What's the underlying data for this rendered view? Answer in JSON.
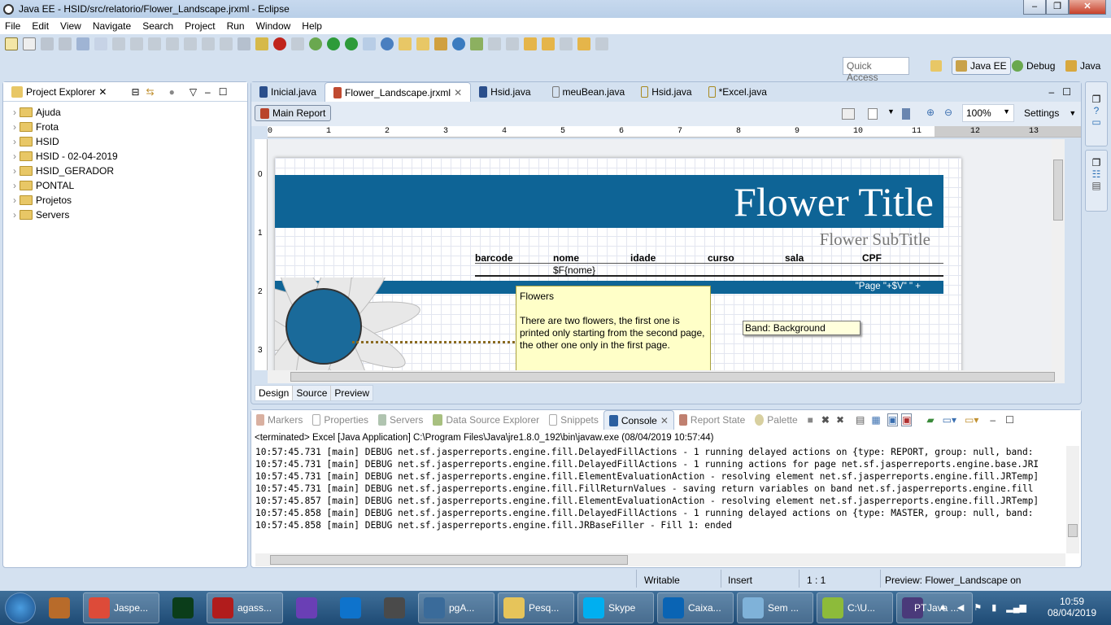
{
  "window": {
    "title": "Java EE - HSID/src/relatorio/Flower_Landscape.jrxml - Eclipse",
    "min": "‒",
    "max": "❐",
    "close": "✕"
  },
  "menu": [
    "File",
    "Edit",
    "View",
    "Navigate",
    "Search",
    "Project",
    "Run",
    "Window",
    "Help"
  ],
  "quick_access": {
    "placeholder": "Quick Access"
  },
  "perspectives": [
    "Java EE",
    "Debug",
    "Java"
  ],
  "project_explorer": {
    "title": "Project Explorer",
    "items": [
      "Ajuda",
      "Frota",
      "HSID",
      "HSID - 02-04-2019",
      "HSID_GERADOR",
      "PONTAL",
      "Projetos",
      "Servers"
    ]
  },
  "editor": {
    "tabs": [
      "Inicial.java",
      "Flower_Landscape.jrxml",
      "Hsid.java",
      "meuBean.java",
      "Hsid.java",
      "*Excel.java"
    ],
    "active_tab": 1,
    "main_report": "Main Report",
    "zoom": "100%",
    "settings": "Settings",
    "ruler": [
      "0",
      "1",
      "2",
      "3",
      "4",
      "5",
      "6",
      "7",
      "8",
      "9",
      "10",
      "11",
      "12",
      "13"
    ],
    "report": {
      "title": "Flower Title",
      "subtitle": "Flower SubTitle",
      "columns": [
        "barcode",
        "nome",
        "idade",
        "curso",
        "sala",
        "CPF"
      ],
      "field": "$F{nome}",
      "page_expr": "\"Page \"+$V\" \" +",
      "note_title": "Flowers",
      "note_body": "There are two flowers, the first one is printed only starting from the second page, the other one only in the first page.",
      "band_label": "Band: Background",
      "vruler": [
        "0",
        "1",
        "2",
        "3"
      ]
    },
    "bottom_tabs": [
      "Design",
      "Source",
      "Preview"
    ],
    "colors": {
      "band": "#0e6496",
      "note": "#ffffc8"
    }
  },
  "console": {
    "tabs": [
      "Markers",
      "Properties",
      "Servers",
      "Data Source Explorer",
      "Snippets",
      "Console",
      "Report State",
      "Palette"
    ],
    "active_tab": 5,
    "header": "<terminated> Excel [Java Application] C:\\Program Files\\Java\\jre1.8.0_192\\bin\\javaw.exe (08/04/2019 10:57:44)",
    "lines": [
      "10:57:45.731 [main] DEBUG net.sf.jasperreports.engine.fill.DelayedFillActions - 1 running delayed actions on {type: REPORT, group: null, band:",
      "10:57:45.731 [main] DEBUG net.sf.jasperreports.engine.fill.DelayedFillActions - 1 running actions for page net.sf.jasperreports.engine.base.JRI",
      "10:57:45.731 [main] DEBUG net.sf.jasperreports.engine.fill.ElementEvaluationAction - resolving element net.sf.jasperreports.engine.fill.JRTemp]",
      "10:57:45.731 [main] DEBUG net.sf.jasperreports.engine.fill.FillReturnValues - saving return variables on band net.sf.jasperreports.engine.fill",
      "10:57:45.857 [main] DEBUG net.sf.jasperreports.engine.fill.ElementEvaluationAction - resolving element net.sf.jasperreports.engine.fill.JRTemp]",
      "10:57:45.858 [main] DEBUG net.sf.jasperreports.engine.fill.DelayedFillActions - 1 running delayed actions on {type: MASTER, group: null, band:",
      "10:57:45.858 [main] DEBUG net.sf.jasperreports.engine.fill.JRBaseFiller - Fill 1: ended"
    ]
  },
  "status": {
    "writable": "Writable",
    "insert": "Insert",
    "position": "1 : 1",
    "preview": "Preview: Flower_Landscape on"
  },
  "taskbar": {
    "items": [
      {
        "label": "",
        "icon": "start",
        "color": "#2d79c7"
      },
      {
        "label": "",
        "icon": "media",
        "color": "#b86b2a"
      },
      {
        "label": "Jaspe...",
        "icon": "chrome",
        "color": "#dd4b39"
      },
      {
        "label": "",
        "icon": "Dw",
        "color": "#0b3d1a"
      },
      {
        "label": "agass...",
        "icon": "Fz",
        "color": "#b11c1c"
      },
      {
        "label": "",
        "icon": "vs",
        "color": "#6a3fb5"
      },
      {
        "label": "",
        "icon": "teamviewer",
        "color": "#0e73cc"
      },
      {
        "label": "",
        "icon": "sublime",
        "color": "#4a4a4a"
      },
      {
        "label": "pgA...",
        "icon": "pgadmin",
        "color": "#3a6b9a"
      },
      {
        "label": "Pesq...",
        "icon": "folder",
        "color": "#e6c45a"
      },
      {
        "label": "Skype",
        "icon": "S",
        "color": "#00aff0"
      },
      {
        "label": "Caixa...",
        "icon": "O",
        "color": "#0a64b4"
      },
      {
        "label": "Sem ...",
        "icon": "notepad",
        "color": "#7fb2d9"
      },
      {
        "label": "C:\\U...",
        "icon": "notepad++",
        "color": "#8dbb3a"
      },
      {
        "label": "Java ...",
        "icon": "eclipse",
        "color": "#4a3a7a"
      }
    ],
    "lang": "PT",
    "time": "10:59",
    "date": "08/04/2019"
  }
}
